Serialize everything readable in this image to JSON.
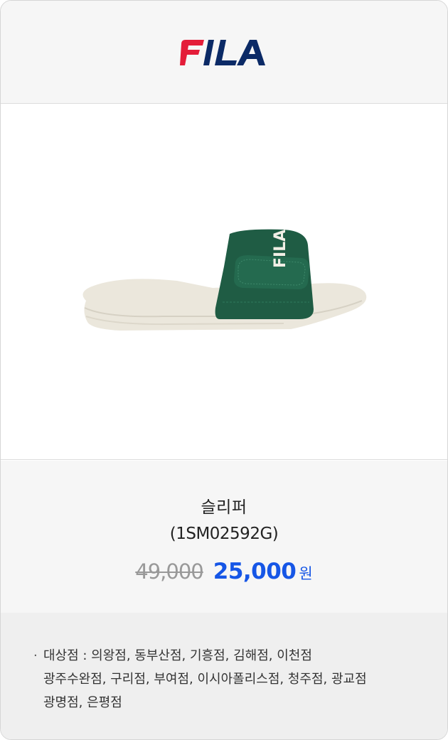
{
  "brand": {
    "name": "FILA",
    "colors": {
      "red": "#e41d39",
      "navy": "#0b2a66"
    }
  },
  "product": {
    "name": "슬리퍼",
    "code": "(1SM02592G)",
    "image_alt": "green FILA slide sandal",
    "colors": {
      "strap": "#1f5c44",
      "sole": "#ebe7dc"
    }
  },
  "price": {
    "original": "49,000",
    "sale": "25,000",
    "unit": "원",
    "accent": "#1656e6"
  },
  "stores": {
    "bullet": "·",
    "lines": [
      "대상점 : 의왕점, 동부산점, 기흥점, 김해점, 이천점",
      "광주수완점, 구리점, 부여점, 이시아폴리스점, 청주점, 광교점",
      "광명점, 은평점"
    ]
  }
}
